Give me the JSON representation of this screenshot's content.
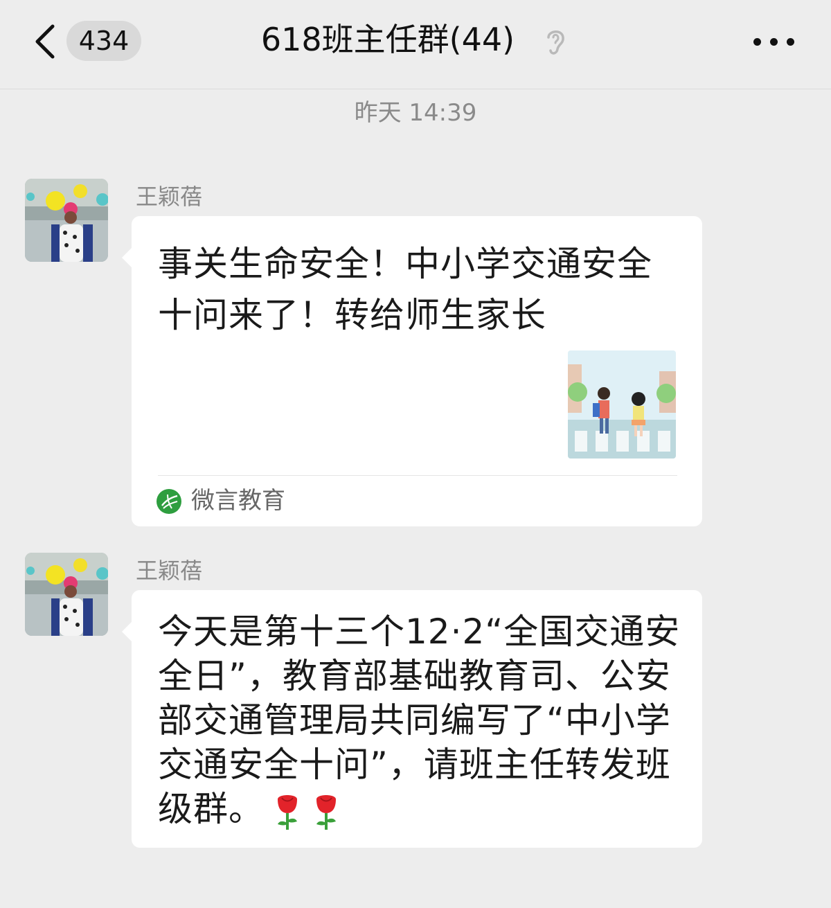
{
  "header": {
    "unread_count": "434",
    "title": "618班主任群(44)"
  },
  "timestamp": "昨天 14:39",
  "messages": [
    {
      "sender": "王颖蓓",
      "type": "article",
      "title": "事关生命安全！中小学交通安全十问来了！转给师生家长",
      "source": "微言教育"
    },
    {
      "sender": "王颖蓓",
      "type": "text",
      "text": "今天是第十三个12·2“全国交通安全日”，教育部基础教育司、公安部交通管理局共同编写了“中小学交通安全十问”，请班主任转发班级群。"
    }
  ],
  "icons": {
    "back": "chevron-left-icon",
    "listen": "ear-icon",
    "more": "more-icon",
    "source_logo": "weiyan-logo-icon",
    "emoji": "rose-icon"
  },
  "colors": {
    "background": "#ededed",
    "bubble": "#ffffff",
    "source_green": "#2e9e3f"
  }
}
